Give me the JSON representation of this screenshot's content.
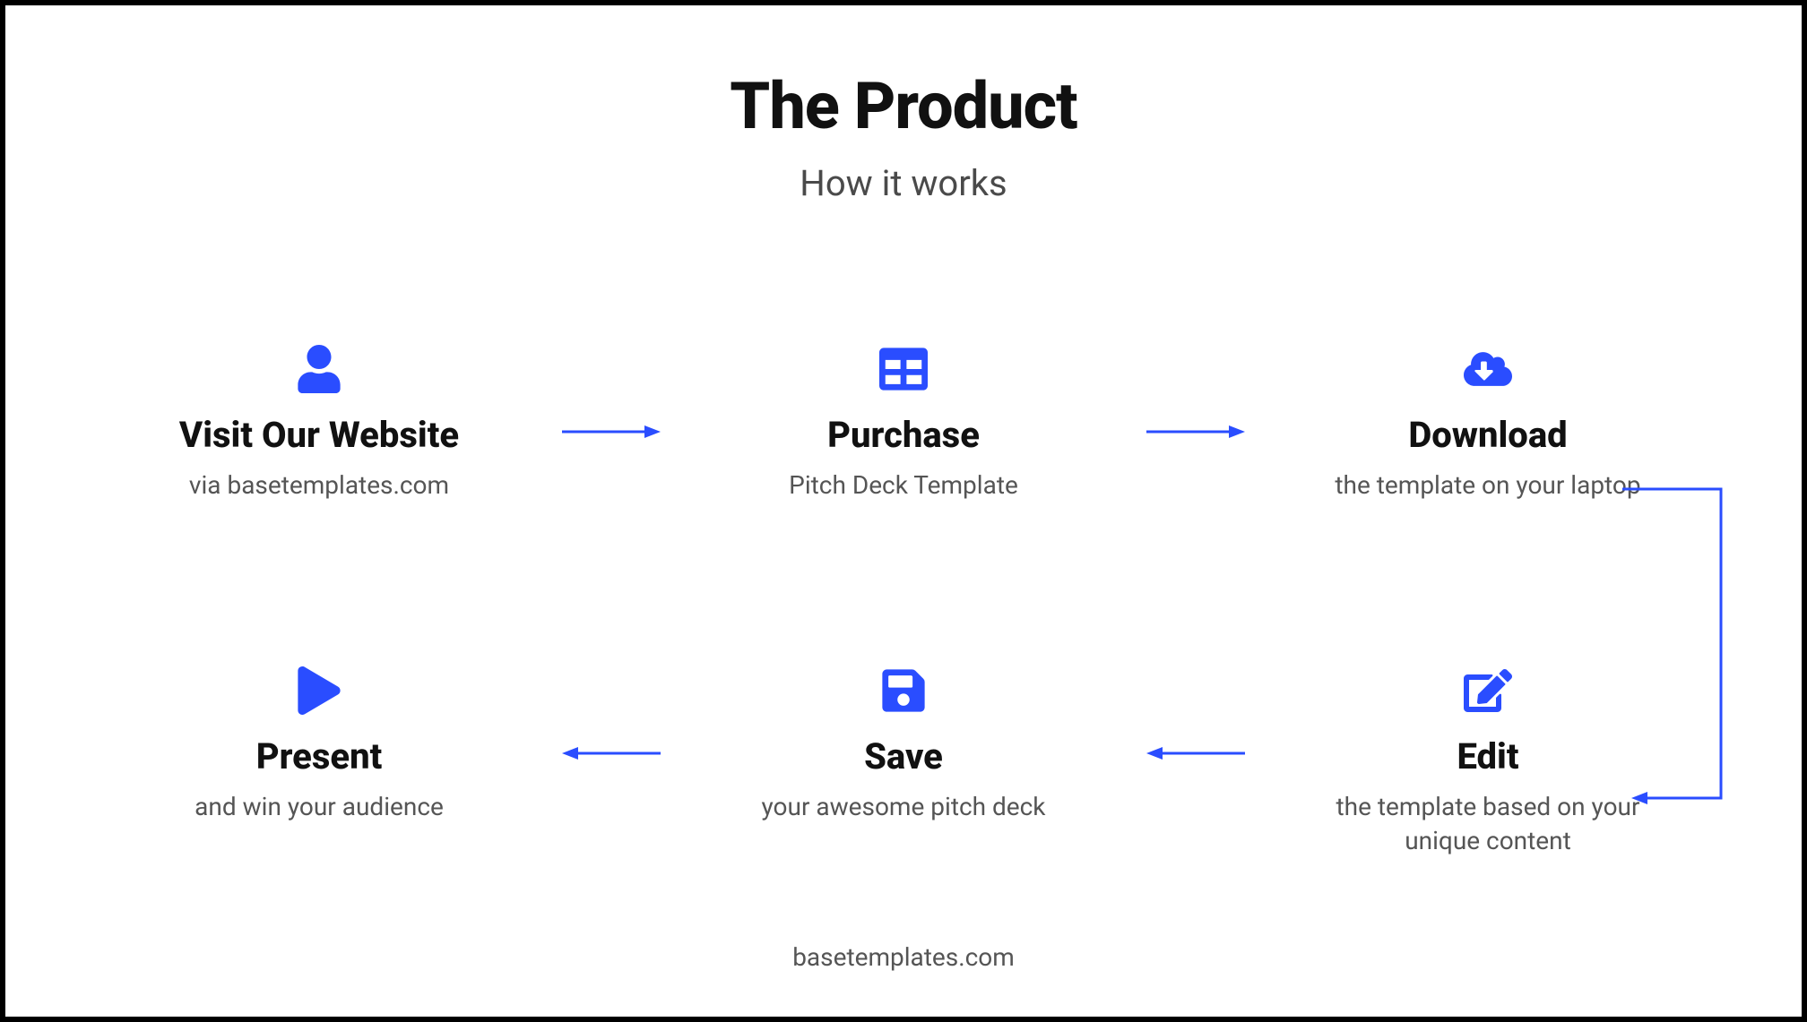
{
  "header": {
    "title": "The Product",
    "subtitle": "How it works"
  },
  "steps": {
    "visit": {
      "title": "Visit Our Website",
      "desc": "via basetemplates.com",
      "icon": "user-icon"
    },
    "purchase": {
      "title": "Purchase",
      "desc": "Pitch Deck Template",
      "icon": "grid-icon"
    },
    "download": {
      "title": "Download",
      "desc": "the template on your laptop",
      "icon": "cloud-download-icon"
    },
    "edit": {
      "title": "Edit",
      "desc": "the template based on your unique content",
      "icon": "edit-icon"
    },
    "save": {
      "title": "Save",
      "desc": "your awesome pitch deck",
      "icon": "save-icon"
    },
    "present": {
      "title": "Present",
      "desc": "and win your audience",
      "icon": "play-icon"
    }
  },
  "footer": {
    "text": "basetemplates.com"
  },
  "colors": {
    "accent": "#2a4dff"
  }
}
